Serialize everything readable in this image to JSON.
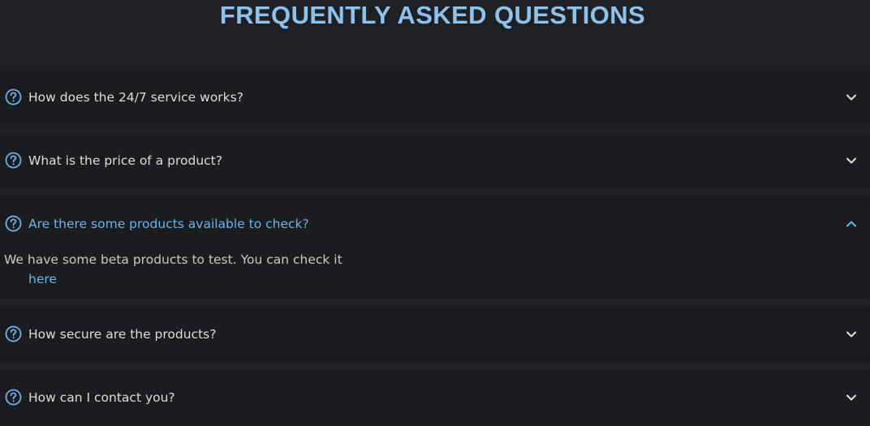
{
  "page": {
    "title": "FREQUENTLY ASKED QUESTIONS"
  },
  "faq": {
    "items": [
      {
        "question": "How does the 24/7 service works?",
        "expanded": false,
        "icon": "question-circle-icon",
        "toggle_icon": "chevron-down-icon"
      },
      {
        "question": "What is the price of a product?",
        "expanded": false,
        "icon": "question-circle-icon",
        "toggle_icon": "chevron-down-icon"
      },
      {
        "question": "Are there some products available to check?",
        "expanded": true,
        "icon": "question-circle-icon",
        "toggle_icon": "chevron-up-icon",
        "answer": "We have some beta products to test. You can check it",
        "answer_link": "here"
      },
      {
        "question": "How secure are the products?",
        "expanded": false,
        "icon": "question-circle-icon",
        "toggle_icon": "chevron-down-icon"
      },
      {
        "question": "How can I contact you?",
        "expanded": false,
        "icon": "question-circle-icon",
        "toggle_icon": "chevron-down-icon"
      }
    ]
  },
  "colors": {
    "background": "#1e2023",
    "item_background": "#1b1c1f",
    "accent": "#6fb3e8",
    "title": "#8ec2ec",
    "text": "#dddddd"
  }
}
